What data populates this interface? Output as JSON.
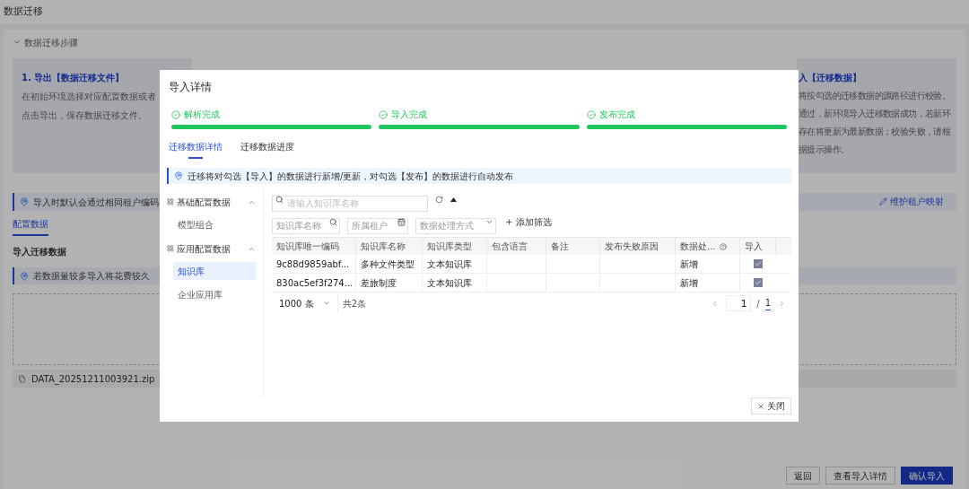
{
  "page": {
    "title": "数据迁移",
    "steps_toggle": {
      "label": "数据迁移步骤",
      "expanded": true
    },
    "left_card": {
      "title": "1. 导出【数据迁移文件】",
      "lines": [
        "在初始环境选择对应配置数据或者",
        "点击导出，保存数据迁移文件。"
      ]
    },
    "right_card": {
      "title": "入【迁移数据】",
      "lines": [
        "将按勾选的迁移数据的源路径进行校验。",
        "通过，新环境导入迁移数据成功，若新环",
        "存在将更新为最新数据；校验失败，请根",
        "据提示操作。"
      ]
    },
    "notice": "导入时默认会通过相同租户编码",
    "mapping_link": "维护租户映射",
    "tabs": [
      {
        "label": "配置数据",
        "selected": true
      }
    ],
    "section_title": "导入迁移数据",
    "notice_2": "若数据量较多导入将花费较久",
    "file": "DATA_20251211003921.zip",
    "buttons": [
      {
        "label": "返回",
        "primary": false
      },
      {
        "label": "查看导入详情",
        "primary": false
      },
      {
        "label": "确认导入",
        "primary": true
      }
    ]
  },
  "dialog": {
    "title": "导入详情",
    "steps": [
      {
        "label": "解析完成",
        "done": true
      },
      {
        "label": "导入完成",
        "done": true
      },
      {
        "label": "发布完成",
        "done": true
      }
    ],
    "tabs": [
      {
        "label": "迁移数据详情",
        "selected": true
      },
      {
        "label": "迁移数据进度",
        "selected": false
      }
    ],
    "notice": "迁移将对勾选【导入】的数据进行新增/更新，对勾选【发布】的数据进行自动发布",
    "sidebar": [
      {
        "label": "基础配置数据",
        "expanded": true,
        "children": [
          {
            "label": "模型组合",
            "selected": false
          }
        ]
      },
      {
        "label": "应用配置数据",
        "expanded": true,
        "children": [
          {
            "label": "知识库",
            "selected": true
          },
          {
            "label": "企业应用库",
            "selected": false
          }
        ]
      }
    ],
    "search": {
      "placeholder": "请输入知识库名称"
    },
    "filters": [
      {
        "kind": "search",
        "placeholder": "知识库名称"
      },
      {
        "kind": "tenant",
        "placeholder": "所属租户"
      },
      {
        "kind": "select",
        "placeholder": "数据处理方式"
      }
    ],
    "add_filter": "添加筛选",
    "columns": [
      {
        "label": "知识库唯一编码",
        "help": false
      },
      {
        "label": "知识库名称",
        "help": false
      },
      {
        "label": "知识库类型",
        "help": false
      },
      {
        "label": "包含语言",
        "help": false
      },
      {
        "label": "备注",
        "help": false
      },
      {
        "label": "发布失败原因",
        "help": false
      },
      {
        "label": "数据处...",
        "help": true
      },
      {
        "label": "导入",
        "help": false
      }
    ],
    "rows": [
      {
        "cells": [
          "9c88d9859abf...",
          "多种文件类型",
          "文本知识库",
          "",
          "",
          "",
          "新增"
        ],
        "import": true
      },
      {
        "cells": [
          "830ac5ef3f274...",
          "差旅制度",
          "文本知识库",
          "",
          "",
          "",
          "新增"
        ],
        "import": true
      }
    ],
    "pagination": {
      "page_size": "1000 条",
      "total": "共2条",
      "page": "1",
      "separator": "/",
      "pages": "1"
    },
    "close_button": "关闭"
  }
}
